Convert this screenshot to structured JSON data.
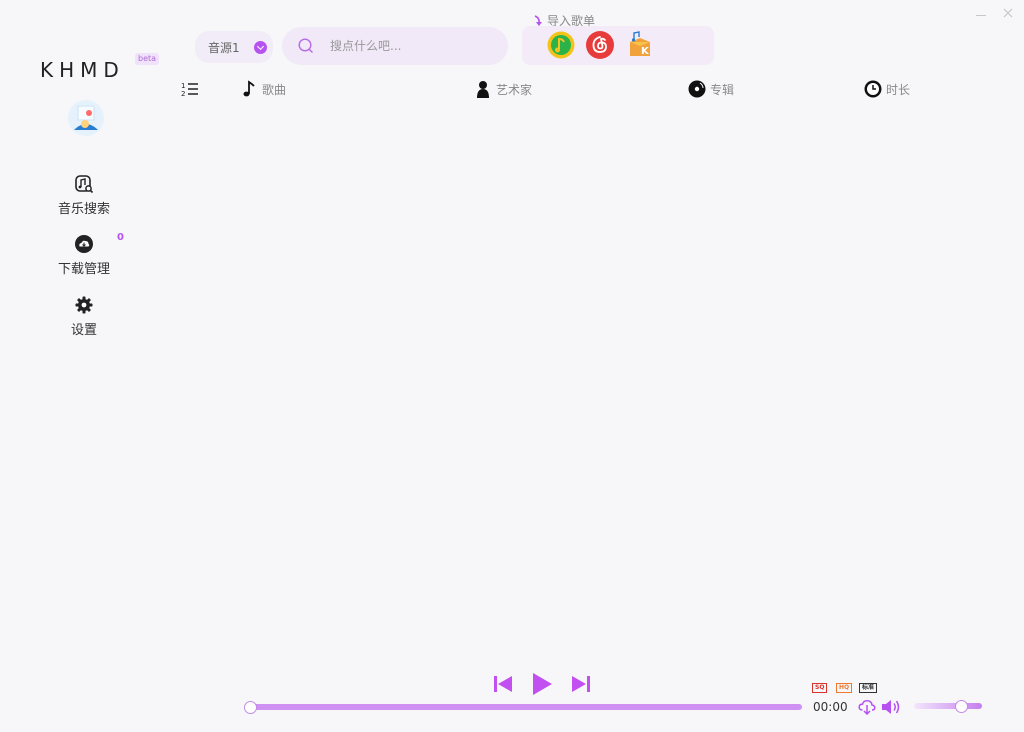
{
  "app": {
    "logo_text": "KHMD",
    "beta_label": "beta"
  },
  "window": {
    "minimize_icon": "minimize-icon",
    "close_icon": "close-icon"
  },
  "sidebar": {
    "items": [
      {
        "label": "音乐搜索",
        "icon": "music-search-icon"
      },
      {
        "label": "下载管理",
        "icon": "cloud-download-icon",
        "badge": "0"
      },
      {
        "label": "设置",
        "icon": "gear-icon"
      }
    ]
  },
  "topbar": {
    "source_value": "音源1",
    "search_placeholder": "搜点什么吧...",
    "import_label": "导入歌单",
    "platforms": [
      {
        "name": "qq-music",
        "icon": "qq-music-icon",
        "color": "#f4c319"
      },
      {
        "name": "netease",
        "icon": "netease-music-icon",
        "color": "#e83c3c"
      },
      {
        "name": "kugou",
        "icon": "kugou-icon",
        "color": "#f2a23a"
      }
    ]
  },
  "columns": {
    "index_icon": "numbered-list-icon",
    "song": "歌曲",
    "artist": "艺术家",
    "album": "专辑",
    "duration": "时长"
  },
  "player": {
    "time": "00:00",
    "progress": 0,
    "volume": 0.7,
    "quality_badges": [
      {
        "label": "SQ",
        "color": "#d9342b"
      },
      {
        "label": "HQ",
        "color": "#ee7a30"
      },
      {
        "label": "标准",
        "color": "#333333"
      }
    ],
    "accent_color": "#b652f0"
  }
}
